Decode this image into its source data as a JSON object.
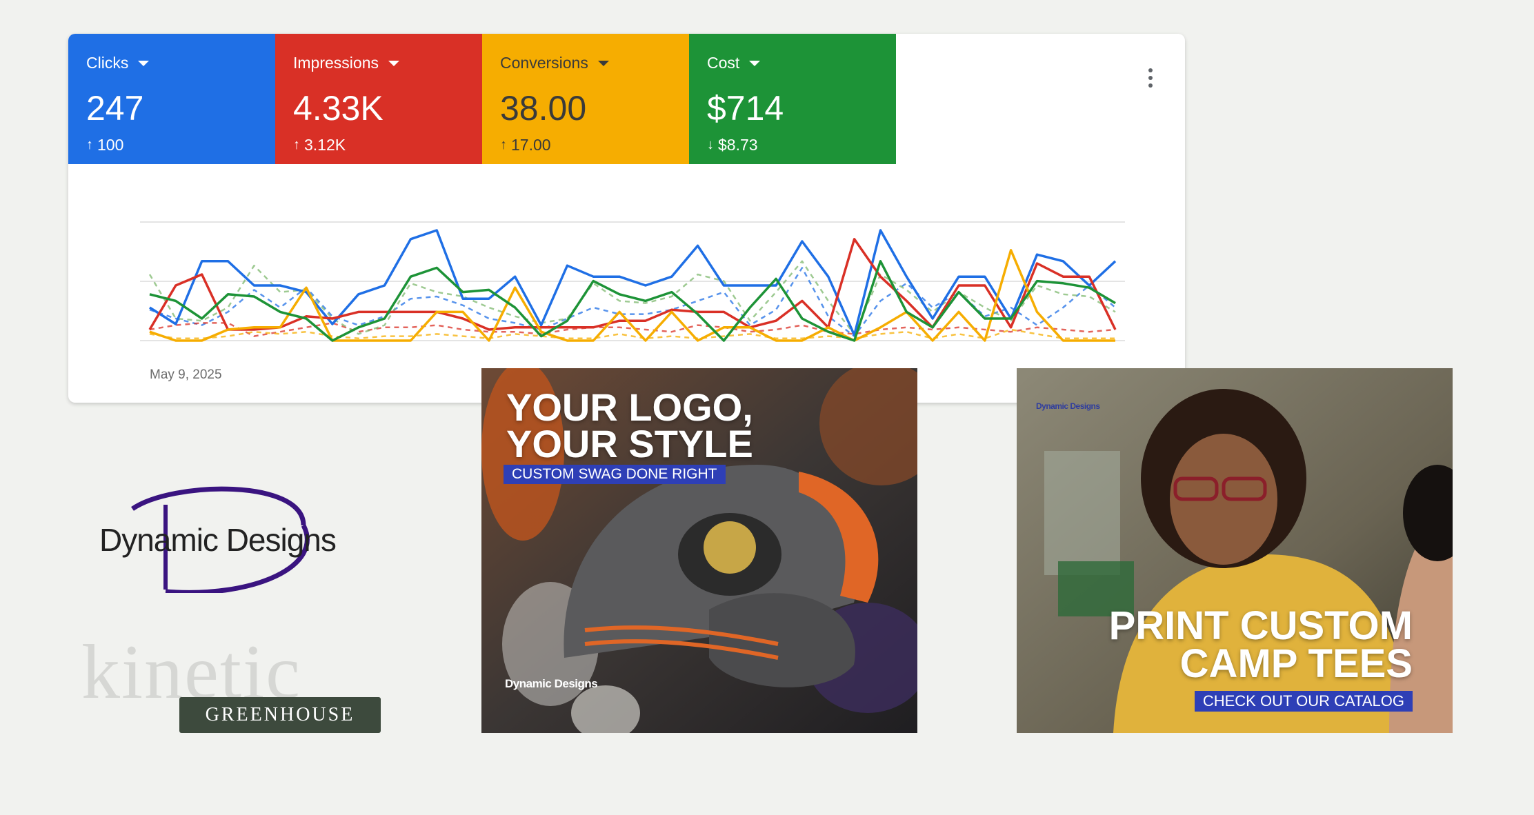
{
  "metrics": [
    {
      "label": "Clicks",
      "value": "247",
      "delta_arrow": "↑",
      "delta": "100",
      "color": "#1f6fe5"
    },
    {
      "label": "Impressions",
      "value": "4.33K",
      "delta_arrow": "↑",
      "delta": "3.12K",
      "color": "#d93026"
    },
    {
      "label": "Conversions",
      "value": "38.00",
      "delta_arrow": "↑",
      "delta": "17.00",
      "color": "#f6ad01"
    },
    {
      "label": "Cost",
      "value": "$714",
      "delta_arrow": "↓",
      "delta": "$8.73",
      "color": "#1d9337"
    }
  ],
  "more_icon": "more-vert-icon",
  "chart_data": {
    "type": "line",
    "x_start_label": "May 9, 2025",
    "grid": true,
    "ylim": [
      0,
      100
    ],
    "series": [
      {
        "color": "#1f6fe5",
        "dashed": false,
        "values": [
          30,
          15,
          72,
          72,
          50,
          50,
          44,
          15,
          42,
          50,
          92,
          100,
          38,
          38,
          58,
          14,
          68,
          58,
          58,
          50,
          58,
          86,
          50,
          50,
          50,
          90,
          58,
          5,
          100,
          58,
          20,
          58,
          58,
          20,
          78,
          72,
          50,
          72
        ]
      },
      {
        "color": "#d93026",
        "dashed": false,
        "values": [
          10,
          50,
          60,
          10,
          10,
          12,
          22,
          20,
          26,
          26,
          26,
          26,
          20,
          10,
          12,
          12,
          12,
          12,
          18,
          18,
          28,
          26,
          26,
          12,
          18,
          36,
          12,
          92,
          58,
          36,
          12,
          50,
          50,
          12,
          70,
          58,
          58,
          10
        ]
      },
      {
        "color": "#f6ad01",
        "dashed": false,
        "values": [
          8,
          0,
          0,
          10,
          12,
          12,
          48,
          0,
          0,
          0,
          0,
          26,
          26,
          0,
          48,
          8,
          0,
          0,
          26,
          0,
          26,
          0,
          12,
          12,
          0,
          0,
          12,
          0,
          12,
          26,
          0,
          26,
          0,
          82,
          26,
          0,
          0,
          0
        ]
      },
      {
        "color": "#1d9337",
        "dashed": false,
        "values": [
          42,
          36,
          20,
          42,
          40,
          26,
          20,
          0,
          12,
          20,
          58,
          66,
          44,
          46,
          30,
          4,
          18,
          54,
          42,
          36,
          44,
          24,
          0,
          30,
          56,
          20,
          8,
          0,
          72,
          26,
          12,
          44,
          20,
          20,
          54,
          52,
          48,
          34
        ]
      },
      {
        "color": "#1f6fe5",
        "dashed": true,
        "values": [
          28,
          20,
          14,
          26,
          46,
          30,
          48,
          22,
          14,
          22,
          38,
          40,
          32,
          20,
          16,
          10,
          20,
          30,
          24,
          24,
          28,
          36,
          44,
          14,
          28,
          66,
          22,
          4,
          36,
          52,
          30,
          44,
          22,
          30,
          14,
          30,
          50,
          30
        ]
      },
      {
        "color": "#d93026",
        "dashed": true,
        "values": [
          10,
          14,
          16,
          16,
          4,
          8,
          12,
          16,
          8,
          12,
          12,
          14,
          10,
          8,
          8,
          6,
          10,
          12,
          12,
          10,
          8,
          14,
          12,
          8,
          10,
          14,
          8,
          6,
          10,
          12,
          10,
          12,
          10,
          8,
          12,
          10,
          8,
          10
        ]
      },
      {
        "color": "#f6ad01",
        "dashed": true,
        "values": [
          6,
          2,
          2,
          4,
          8,
          6,
          8,
          4,
          2,
          4,
          4,
          6,
          4,
          2,
          6,
          4,
          2,
          2,
          6,
          2,
          4,
          2,
          4,
          6,
          2,
          2,
          4,
          2,
          6,
          8,
          2,
          6,
          2,
          10,
          6,
          2,
          2,
          2
        ]
      },
      {
        "color": "#7db86e",
        "dashed": true,
        "values": [
          60,
          20,
          18,
          30,
          68,
          44,
          46,
          20,
          6,
          14,
          52,
          44,
          40,
          30,
          22,
          16,
          20,
          52,
          36,
          34,
          40,
          60,
          54,
          18,
          44,
          72,
          36,
          6,
          60,
          46,
          26,
          44,
          30,
          18,
          50,
          42,
          40,
          26
        ]
      }
    ]
  },
  "logos": {
    "dynamic_designs": "Dynamic Designs",
    "kinetic": "kinetic",
    "greenhouse": "GREENHOUSE"
  },
  "ads": {
    "ad1": {
      "headline_1": "YOUR LOGO,",
      "headline_2": "YOUR STYLE",
      "tagline": "CUSTOM SWAG DONE RIGHT",
      "logo": "Dynamic Designs"
    },
    "ad2": {
      "headline_1": "PRINT CUSTOM",
      "headline_2": "CAMP TEES",
      "tagline": "CHECK OUT OUR CATALOG",
      "logo": "Dynamic Designs"
    }
  }
}
